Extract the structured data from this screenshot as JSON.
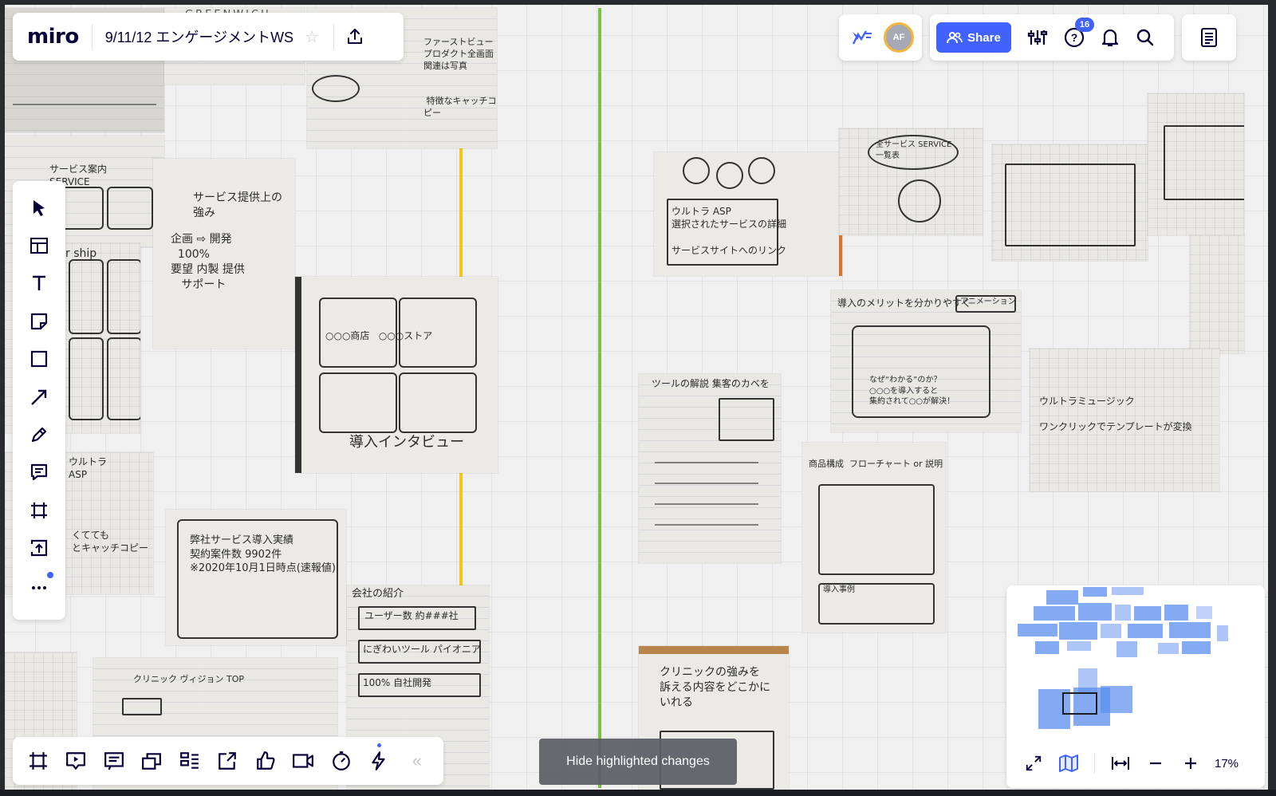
{
  "board": {
    "logo": "miro",
    "title": "9/11/12 エンゲージメントWS"
  },
  "topbar": {
    "avatar_initials": "AF",
    "share_label": "Share",
    "help_badge": "16"
  },
  "toast": {
    "label": "Hide highlighted changes"
  },
  "zoom": {
    "value": "17%"
  },
  "colors": {
    "accent": "#4262ff",
    "guide_yellow": "#f5c518",
    "guide_green": "#7cc242"
  },
  "sketches": {
    "a": "ファーストビュー\nプロダクト全画面\n関連は写真\n\n\n 特徴なキャッチコピー",
    "b": "サービス提供上の\n強み",
    "c": "企画 ⇨ 開発\n  100%\n要望 内製 提供\n   サポート",
    "d": "○○○商店   ○○○ストア",
    "e": "導入インタビュー",
    "f": "弊社サービス導入実績\n契約案件数 9902件\n※2020年10月1日時点(速報値)",
    "g": "会社の紹介",
    "h": "ユーザー数 約###社",
    "i": "にぎわいツール パイオニア",
    "j": "100% 自社開発",
    "k": "クリニック ヴィジョン TOP",
    "l": "ウルトラ ASP\n選択されたサービスの詳細\n\nサービスサイトへのリンク",
    "m": "全サービス SERVICE\n一覧表",
    "n": "導入のメリットを分かりやすく",
    "o": "アニメーション",
    "p": "なぜ“わかる”のか？\n○○○を導入すると\n集約されて○○が解決！",
    "q": "ツールの解説 集客のカベを",
    "r": "商品構成  フローチャート or 説明",
    "s": "導入事例",
    "t": "ウルトラミュージック\n\nワンクリックでテンプレートが変換",
    "u": "クリニックの強みを\n訴える内容をどこかに\nいれる",
    "v": "サービス案内\nSERVICE"
  }
}
